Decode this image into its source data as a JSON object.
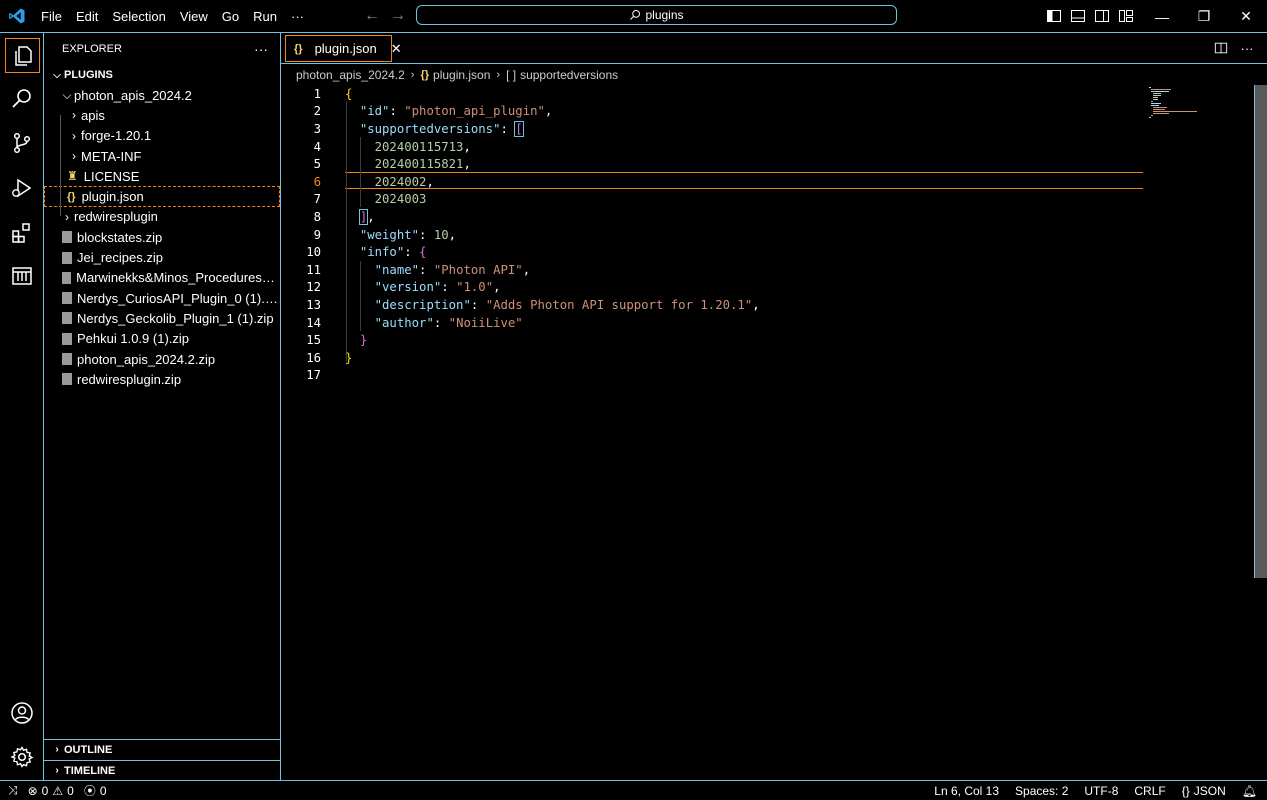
{
  "menu": [
    "File",
    "Edit",
    "Selection",
    "View",
    "Go",
    "Run",
    "···"
  ],
  "command_center": "plugins",
  "explorer": {
    "title": "EXPLORER",
    "more": "···",
    "root": "PLUGINS",
    "items": [
      {
        "label": "photon_apis_2024.2",
        "kind": "folder-open",
        "depth": 1
      },
      {
        "label": "apis",
        "kind": "folder",
        "depth": 2
      },
      {
        "label": "forge-1.20.1",
        "kind": "folder",
        "depth": 2
      },
      {
        "label": "META-INF",
        "kind": "folder",
        "depth": 2
      },
      {
        "label": "LICENSE",
        "kind": "license",
        "depth": 2
      },
      {
        "label": "plugin.json",
        "kind": "json",
        "depth": 2,
        "selected": true
      },
      {
        "label": "redwiresplugin",
        "kind": "folder",
        "depth": 1
      },
      {
        "label": "blockstates.zip",
        "kind": "zip",
        "depth": 1
      },
      {
        "label": "Jei_recipes.zip",
        "kind": "zip",
        "depth": 1
      },
      {
        "label": "Marwinekks&Minos_Procedures_Plu...",
        "kind": "zip",
        "depth": 1
      },
      {
        "label": "Nerdys_CuriosAPI_Plugin_0 (1).zip",
        "kind": "zip",
        "depth": 1
      },
      {
        "label": "Nerdys_Geckolib_Plugin_1 (1).zip",
        "kind": "zip",
        "depth": 1
      },
      {
        "label": "Pehkui 1.0.9 (1).zip",
        "kind": "zip",
        "depth": 1
      },
      {
        "label": "photon_apis_2024.2.zip",
        "kind": "zip",
        "depth": 1
      },
      {
        "label": "redwiresplugin.zip",
        "kind": "zip",
        "depth": 1
      }
    ],
    "outline": "OUTLINE",
    "timeline": "TIMELINE"
  },
  "tab": {
    "icon": "{}",
    "label": "plugin.json",
    "close": "✕"
  },
  "breadcrumbs": {
    "folder": "photon_apis_2024.2",
    "file_icon": "{}",
    "file": "plugin.json",
    "symbol_icon": "[ ]",
    "symbol": "supportedversions"
  },
  "code_lines": [
    [
      {
        "t": "{",
        "c": "b1"
      }
    ],
    [
      {
        "t": "  "
      },
      {
        "t": "\"id\"",
        "c": "k"
      },
      {
        "t": ": "
      },
      {
        "t": "\"photon_api_plugin\"",
        "c": "s"
      },
      {
        "t": ","
      }
    ],
    [
      {
        "t": "  "
      },
      {
        "t": "\"supportedversions\"",
        "c": "k"
      },
      {
        "t": ": "
      },
      {
        "t": "[",
        "c": "b2 bracket-box"
      }
    ],
    [
      {
        "t": "    "
      },
      {
        "t": "202400115713",
        "c": "n"
      },
      {
        "t": ","
      }
    ],
    [
      {
        "t": "    "
      },
      {
        "t": "202400115821",
        "c": "n"
      },
      {
        "t": ","
      }
    ],
    [
      {
        "t": "    "
      },
      {
        "t": "2024002",
        "c": "n"
      },
      {
        "t": ","
      }
    ],
    [
      {
        "t": "    "
      },
      {
        "t": "2024003",
        "c": "n"
      }
    ],
    [
      {
        "t": "  "
      },
      {
        "t": "]",
        "c": "b2 bracket-box"
      },
      {
        "t": ","
      }
    ],
    [
      {
        "t": "  "
      },
      {
        "t": "\"weight\"",
        "c": "k"
      },
      {
        "t": ": "
      },
      {
        "t": "10",
        "c": "n"
      },
      {
        "t": ","
      }
    ],
    [
      {
        "t": "  "
      },
      {
        "t": "\"info\"",
        "c": "k"
      },
      {
        "t": ": "
      },
      {
        "t": "{",
        "c": "b2"
      }
    ],
    [
      {
        "t": "    "
      },
      {
        "t": "\"name\"",
        "c": "k"
      },
      {
        "t": ": "
      },
      {
        "t": "\"Photon API\"",
        "c": "s"
      },
      {
        "t": ","
      }
    ],
    [
      {
        "t": "    "
      },
      {
        "t": "\"version\"",
        "c": "k"
      },
      {
        "t": ": "
      },
      {
        "t": "\"1.0\"",
        "c": "s"
      },
      {
        "t": ","
      }
    ],
    [
      {
        "t": "    "
      },
      {
        "t": "\"description\"",
        "c": "k"
      },
      {
        "t": ": "
      },
      {
        "t": "\"Adds Photon API support for 1.20.1\"",
        "c": "s"
      },
      {
        "t": ","
      }
    ],
    [
      {
        "t": "    "
      },
      {
        "t": "\"author\"",
        "c": "k"
      },
      {
        "t": ": "
      },
      {
        "t": "\"NoiiLive\"",
        "c": "s"
      }
    ],
    [
      {
        "t": "  "
      },
      {
        "t": "}",
        "c": "b2"
      }
    ],
    [
      {
        "t": "}",
        "c": "b1"
      }
    ],
    []
  ],
  "current_line": 6,
  "status": {
    "errors": "0",
    "warnings": "0",
    "ports": "0",
    "position": "Ln 6, Col 13",
    "spaces": "Spaces: 2",
    "encoding": "UTF-8",
    "eol": "CRLF",
    "language_icon": "{}",
    "language": "JSON"
  },
  "colors": {
    "accent": "#6fc3df",
    "active_border": "#f38518",
    "background": "#000000"
  }
}
